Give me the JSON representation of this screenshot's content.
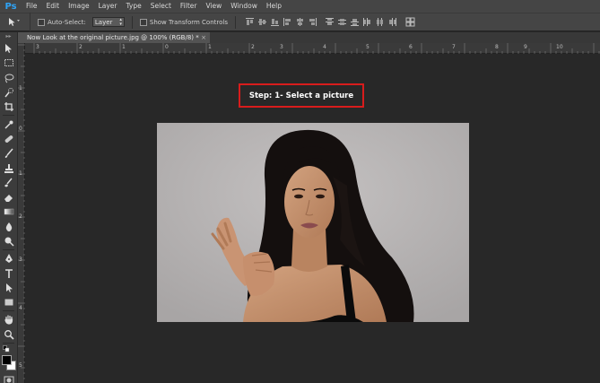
{
  "app": {
    "logo": "Ps"
  },
  "menu": [
    "File",
    "Edit",
    "Image",
    "Layer",
    "Type",
    "Select",
    "Filter",
    "View",
    "Window",
    "Help"
  ],
  "options": {
    "tool_icon": "move-tool-icon",
    "auto_select_label": "Auto-Select:",
    "auto_select_value": "Layer",
    "show_transform_label": "Show Transform Controls"
  },
  "document": {
    "tab_title": "Now Look at the original picture.jpg @ 100% (RGB/8) *",
    "close_glyph": "×"
  },
  "ruler": {
    "top_numbers": [
      "3",
      "2",
      "1",
      "0",
      "1",
      "2",
      "3",
      "4",
      "5",
      "6",
      "7",
      "8",
      "9",
      "10"
    ],
    "left_numbers": [
      "1",
      "0",
      "1",
      "2",
      "3",
      "4",
      "5"
    ]
  },
  "overlay": {
    "step_label": "Step: 1- Select a picture"
  },
  "tools": [
    "move",
    "marquee",
    "lasso",
    "quick-select",
    "crop",
    "eyedropper",
    "healing",
    "brush",
    "stamp",
    "history-brush",
    "eraser",
    "gradient",
    "blur",
    "dodge",
    "pen",
    "type",
    "path-select",
    "shape",
    "hand",
    "zoom"
  ],
  "colors": {
    "accent": "#2fa3f5",
    "highlight": "#d81c1c",
    "panel": "#454545",
    "canvas": "#282828"
  }
}
